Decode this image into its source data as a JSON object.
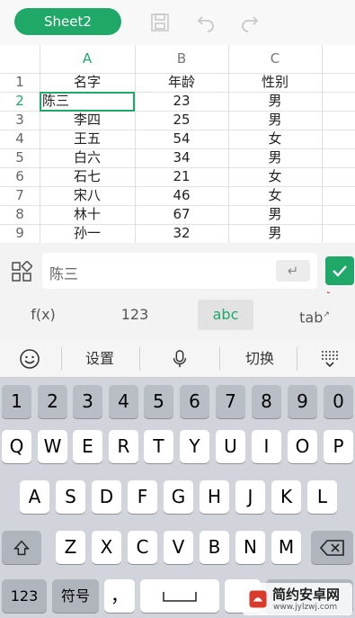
{
  "topbar": {
    "sheet_name": "Sheet2"
  },
  "grid": {
    "columns": [
      "A",
      "B",
      "C"
    ],
    "header_row": {
      "num": "1",
      "cells": [
        "名字",
        "年龄",
        "性别"
      ]
    },
    "rows": [
      {
        "num": "2",
        "cells": [
          "陈三",
          "23",
          "男"
        ]
      },
      {
        "num": "3",
        "cells": [
          "李四",
          "25",
          "男"
        ]
      },
      {
        "num": "4",
        "cells": [
          "王五",
          "54",
          "女"
        ]
      },
      {
        "num": "5",
        "cells": [
          "白六",
          "34",
          "男"
        ]
      },
      {
        "num": "6",
        "cells": [
          "石七",
          "21",
          "女"
        ]
      },
      {
        "num": "7",
        "cells": [
          "宋八",
          "46",
          "女"
        ]
      },
      {
        "num": "8",
        "cells": [
          "林十",
          "67",
          "男"
        ]
      },
      {
        "num": "9",
        "cells": [
          "孙一",
          "32",
          "男"
        ]
      }
    ]
  },
  "input": {
    "value": "陈三",
    "enter_label": "↵"
  },
  "modes": {
    "fx": "f(x)",
    "num": "123",
    "abc": "abc",
    "tab": "tab"
  },
  "keyboard": {
    "toolbar": {
      "settings": "设置",
      "switch": "切换"
    },
    "row_digits": [
      "1",
      "2",
      "3",
      "4",
      "5",
      "6",
      "7",
      "8",
      "9",
      "0"
    ],
    "row1": [
      "Q",
      "W",
      "E",
      "R",
      "T",
      "Y",
      "U",
      "I",
      "O",
      "P"
    ],
    "row2": [
      "A",
      "S",
      "D",
      "F",
      "G",
      "H",
      "J",
      "K",
      "L"
    ],
    "row3": [
      "Z",
      "X",
      "C",
      "V",
      "B",
      "N",
      "M"
    ],
    "bottom": {
      "num": "123",
      "symbol": "符号",
      "comma": "，"
    }
  },
  "watermark": {
    "text": "简约安卓网",
    "url": "www.jylzwj.com"
  }
}
